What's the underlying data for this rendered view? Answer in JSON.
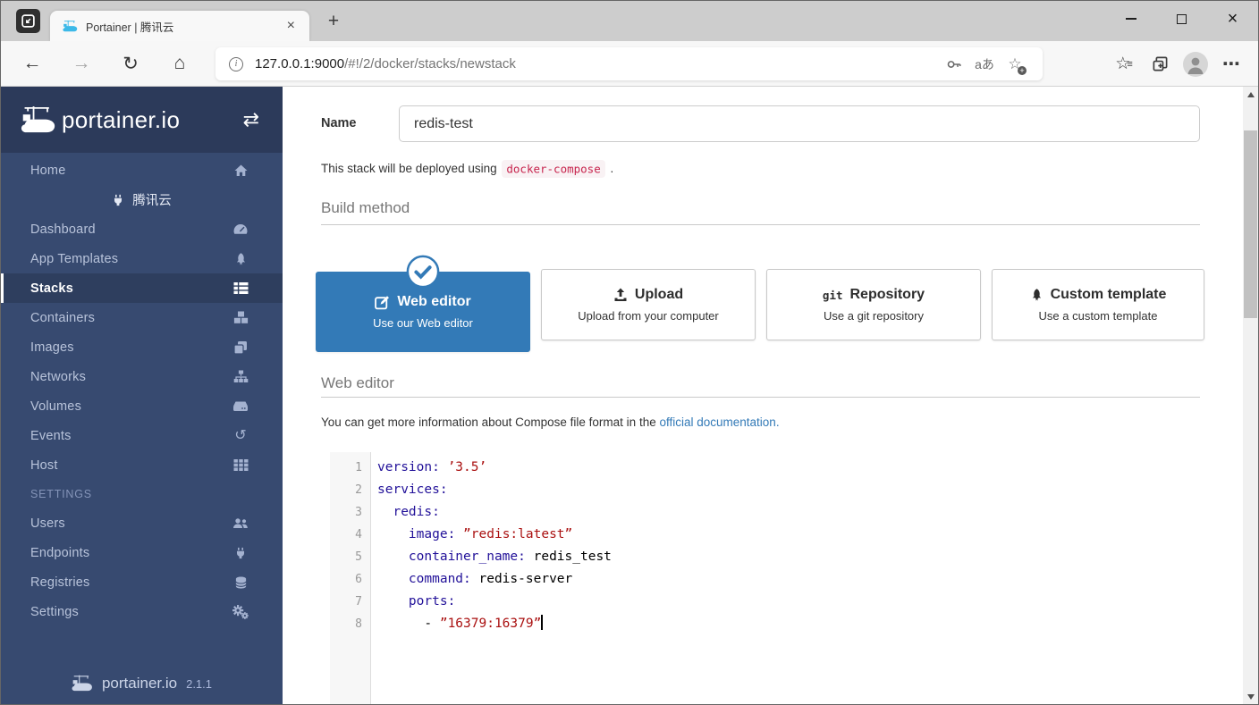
{
  "colors": {
    "accent": "#337ab7",
    "link": "#337ab7",
    "sidebar-bg": "#374a70",
    "sidebar-header-bg": "#2c3a5a",
    "sidebar-active-bg": "#2e3e5e",
    "code-key": "#221199",
    "code-string": "#aa1111",
    "badge-bg": "#f9f2f4",
    "badge-fg": "#c7254e"
  },
  "browser": {
    "tab_title": "Portainer | 腾讯云",
    "url_host": "127.0.0.1:9000",
    "url_path": "/#!/2/docker/stacks/newstack",
    "translate_label": "aあ",
    "glyphs": {
      "back": "←",
      "forward": "→",
      "refresh": "↻",
      "home": "⌂",
      "info": "i",
      "star": "☆",
      "star_lines": "≡",
      "more": "⋯",
      "tab_close": "×",
      "window_close": "×",
      "new_tab": "+"
    }
  },
  "sidebar": {
    "logo_text": "portainer.io",
    "toggle_glyph": "⇄",
    "home_label": "Home",
    "endpoint_label": "腾讯云",
    "items": [
      {
        "label": "Dashboard",
        "icon": "tachometer-icon"
      },
      {
        "label": "App Templates",
        "icon": "rocket-icon"
      },
      {
        "label": "Stacks",
        "icon": "list-icon",
        "active": true
      },
      {
        "label": "Containers",
        "icon": "cubes-icon"
      },
      {
        "label": "Images",
        "icon": "images-icon"
      },
      {
        "label": "Networks",
        "icon": "sitemap-icon"
      },
      {
        "label": "Volumes",
        "icon": "hdd-icon"
      },
      {
        "label": "Events",
        "icon": "history-icon",
        "glyph": "↺"
      },
      {
        "label": "Host",
        "icon": "grid-icon"
      }
    ],
    "settings_header": "SETTINGS",
    "settings_items": [
      {
        "label": "Users",
        "icon": "users-icon"
      },
      {
        "label": "Endpoints",
        "icon": "plug-icon"
      },
      {
        "label": "Registries",
        "icon": "database-icon"
      },
      {
        "label": "Settings",
        "icon": "cogs-icon"
      }
    ],
    "footer_logo_text": "portainer.io",
    "version": "2.1.1"
  },
  "main": {
    "name_label": "Name",
    "name_value": "redis-test",
    "deploy_prefix": "This stack will be deployed using",
    "deploy_code": "docker-compose",
    "deploy_suffix": ".",
    "build_method_title": "Build method",
    "options": [
      {
        "title": "Web editor",
        "subtitle": "Use our Web editor",
        "selected": true
      },
      {
        "title": "Upload",
        "subtitle": "Upload from your computer"
      },
      {
        "title": "Repository",
        "subtitle": "Use a git repository",
        "icon_text": "git"
      },
      {
        "title": "Custom template",
        "subtitle": "Use a custom template"
      }
    ],
    "web_editor_title": "Web editor",
    "info_prefix": "You can get more information about Compose file format in the",
    "info_link": "official documentation.",
    "code_lines": [
      {
        "num": "1",
        "tokens": [
          {
            "c": "key",
            "t": "version:"
          },
          {
            "c": "plain",
            "t": " "
          },
          {
            "c": "str",
            "t": "’3.5’"
          }
        ]
      },
      {
        "num": "2",
        "tokens": [
          {
            "c": "key",
            "t": "services:"
          }
        ]
      },
      {
        "num": "3",
        "tokens": [
          {
            "c": "plain",
            "t": "  "
          },
          {
            "c": "key",
            "t": "redis:"
          }
        ]
      },
      {
        "num": "4",
        "tokens": [
          {
            "c": "plain",
            "t": "    "
          },
          {
            "c": "key",
            "t": "image:"
          },
          {
            "c": "plain",
            "t": " "
          },
          {
            "c": "str",
            "t": "”redis:latest”"
          }
        ]
      },
      {
        "num": "5",
        "tokens": [
          {
            "c": "plain",
            "t": "    "
          },
          {
            "c": "key",
            "t": "container_name:"
          },
          {
            "c": "plain",
            "t": " redis_test"
          }
        ]
      },
      {
        "num": "6",
        "tokens": [
          {
            "c": "plain",
            "t": "    "
          },
          {
            "c": "key",
            "t": "command:"
          },
          {
            "c": "plain",
            "t": " redis-server"
          }
        ]
      },
      {
        "num": "7",
        "tokens": [
          {
            "c": "plain",
            "t": "    "
          },
          {
            "c": "key",
            "t": "ports:"
          }
        ]
      },
      {
        "num": "8",
        "caret": true,
        "tokens": [
          {
            "c": "plain",
            "t": "      - "
          },
          {
            "c": "str",
            "t": "”16379:16379”"
          }
        ]
      }
    ]
  }
}
